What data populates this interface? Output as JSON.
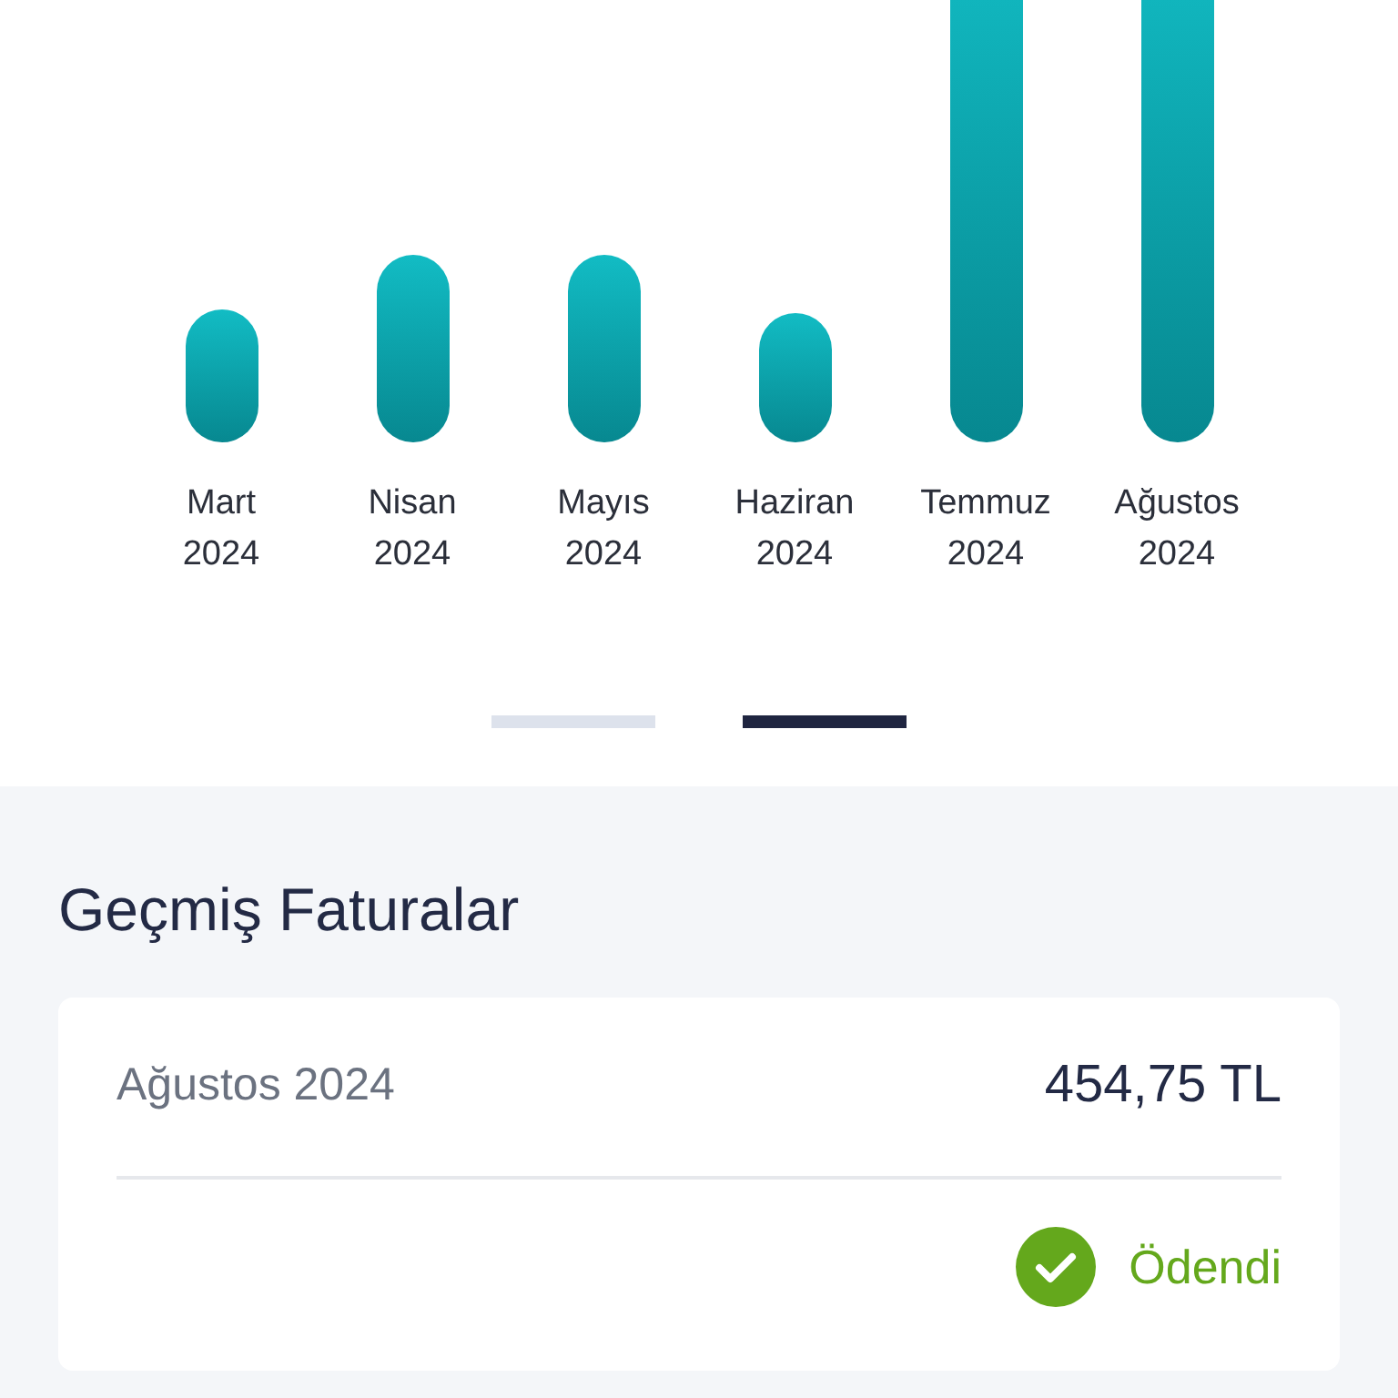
{
  "chart": {
    "months": [
      {
        "name": "Mart",
        "year": "2024"
      },
      {
        "name": "Nisan",
        "year": "2024"
      },
      {
        "name": "Mayıs",
        "year": "2024"
      },
      {
        "name": "Haziran",
        "year": "2024"
      },
      {
        "name": "Temmuz",
        "year": "2024"
      },
      {
        "name": "Ağustos",
        "year": "2024"
      }
    ]
  },
  "pager": [
    {
      "selected": false
    },
    {
      "selected": true
    }
  ],
  "history": {
    "title": "Geçmiş Faturalar",
    "invoices": [
      {
        "period": "Ağustos 2024",
        "amount": "454,75 TL",
        "status": "Ödendi",
        "paid": true
      }
    ]
  }
}
